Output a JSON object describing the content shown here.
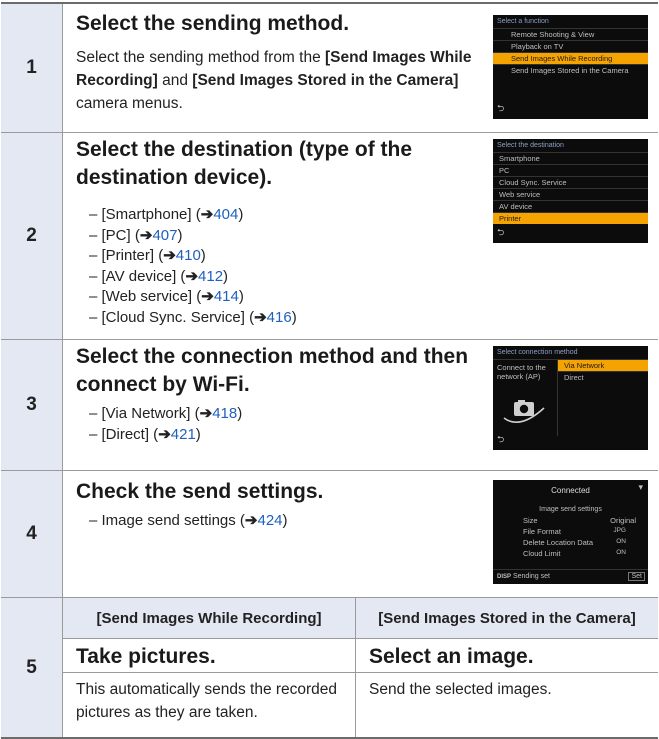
{
  "steps": [
    {
      "number": "1",
      "title": "Select the sending method.",
      "body_pre": "Select the sending method from the ",
      "body_b1": "[Send Images While Recording]",
      "body_mid": " and ",
      "body_b2": "[Send Images Stored in the Camera]",
      "body_post": " camera menus.",
      "screen": {
        "title": "Select a function",
        "items": [
          "Remote Shooting & View",
          "Playback on TV",
          "Send Images While Recording",
          "Send Images Stored in the Camera"
        ]
      }
    },
    {
      "number": "2",
      "title_line1": "Select the destination (type of the",
      "title_line2": "destination device).",
      "options": [
        {
          "label": "– [Smartphone] (",
          "page": "404"
        },
        {
          "label": "– [PC] (",
          "page": "407"
        },
        {
          "label": "– [Printer] (",
          "page": "410"
        },
        {
          "label": "– [AV device] (",
          "page": "412"
        },
        {
          "label": "– [Web service] (",
          "page": "414"
        },
        {
          "label": "– [Cloud Sync. Service] (",
          "page": "416"
        }
      ],
      "screen": {
        "title": "Select the destination",
        "items": [
          "Smartphone",
          "PC",
          "Cloud Sync. Service",
          "Web service",
          "AV device",
          "Printer"
        ]
      }
    },
    {
      "number": "3",
      "title_line1": "Select the connection method and then",
      "title_line2": "connect by Wi-Fi.",
      "options": [
        {
          "label": "– [Via Network] (",
          "page": "418"
        },
        {
          "label": "– [Direct] (",
          "page": "421"
        }
      ],
      "screen": {
        "title": "Select connection method",
        "left_text": "Connect to the network (AP)",
        "opt1": "Via Network",
        "opt2": "Direct"
      }
    },
    {
      "number": "4",
      "title": "Check the send settings.",
      "options": [
        {
          "label": "– Image send settings (",
          "page": "424"
        }
      ],
      "screen": {
        "status": "Connected",
        "subtitle": "Image send settings",
        "rows": [
          {
            "k": "Size",
            "v": "Original"
          },
          {
            "k": "File Format",
            "v": "JPG"
          },
          {
            "k": "Delete Location Data",
            "v": "ON"
          },
          {
            "k": "Cloud Limit",
            "v": "ON"
          }
        ],
        "footer_left": "Sending set",
        "footer_right": "Set"
      }
    },
    {
      "number": "5",
      "col1_header": "[Send Images While Recording]",
      "col2_header": "[Send Images Stored in the Camera]",
      "col1_title": "Take pictures.",
      "col1_body": "This automatically sends the recorded pictures as they are taken.",
      "col2_title": "Select an image.",
      "col2_body": "Send the selected images."
    }
  ],
  "arrow_glyph": "➔",
  "back_glyph": "⮌"
}
